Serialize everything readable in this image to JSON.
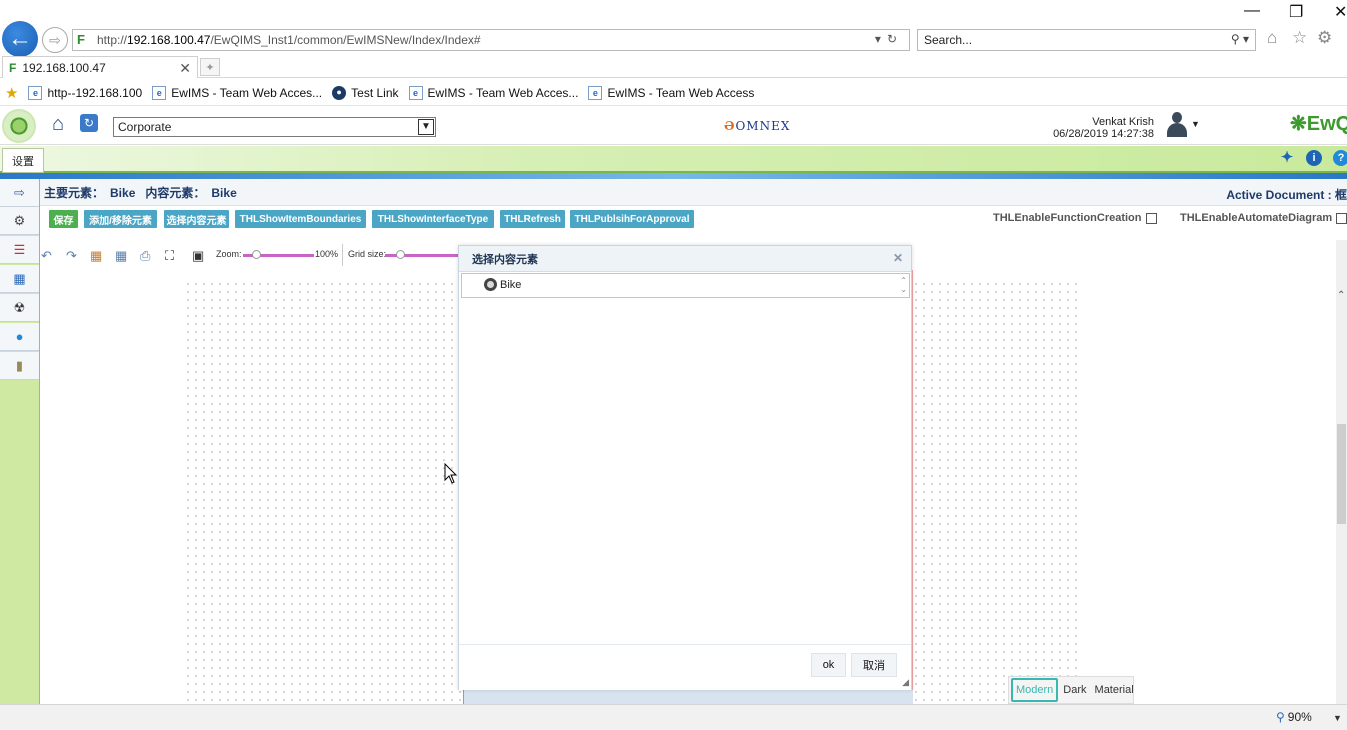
{
  "browser": {
    "url_prefix": "http://",
    "url_host": "192.168.100.47",
    "url_path": "/EwQIMS_Inst1/common/EwIMSNew/Index/Index#",
    "search_placeholder": "Search...",
    "tab_title": "192.168.100.47",
    "favorites": [
      {
        "label": "http--192.168.100",
        "icon": "ie-page-icon"
      },
      {
        "label": "EwIMS - Team Web Acces...",
        "icon": "ie-page-icon"
      },
      {
        "label": "Test Link",
        "icon": "testlink-icon"
      },
      {
        "label": "EwIMS - Team Web Acces...",
        "icon": "ie-page-icon"
      },
      {
        "label": "EwIMS - Team Web Access",
        "icon": "ie-page-icon"
      }
    ],
    "zoom": "90%"
  },
  "header": {
    "org_select": "Corporate",
    "center_logo": "OMNEX",
    "user_name": "Venkat Krish",
    "user_time": "06/28/2019 14:27:38",
    "brand": "EwQ"
  },
  "menu": {
    "tab_label": "设置"
  },
  "info": {
    "main_label": "主要元素：",
    "main_value": "Bike",
    "content_label": "内容元素：",
    "content_value": "Bike",
    "active_doc": "Active Document : 框"
  },
  "toolbar": {
    "buttons": [
      {
        "label": "保存",
        "color": "#4caf50"
      },
      {
        "label": "添加/移除元素",
        "color": "#4ba6c5"
      },
      {
        "label": "选择内容元素",
        "color": "#4ba6c5"
      },
      {
        "label": "THLShowItemBoundaries",
        "color": "#4ba6c5"
      },
      {
        "label": "THLShowInterfaceType",
        "color": "#4ba6c5"
      },
      {
        "label": "THLRefresh",
        "color": "#4ba6c5"
      },
      {
        "label": "THLPublsihForApproval",
        "color": "#4ba6c5"
      }
    ],
    "check_function": "THLEnableFunctionCreation",
    "check_automate": "THLEnableAutomateDiagram"
  },
  "diagram_tools": {
    "zoom_label": "Zoom:",
    "zoom_value": "100%",
    "grid_label": "Grid size:"
  },
  "dialog": {
    "title": "选择内容元素",
    "items": [
      "Bike"
    ],
    "ok_label": "ok",
    "cancel_label": "取消"
  },
  "themes": {
    "modern": "Modern",
    "dark": "Dark",
    "material": "Material",
    "selected": "Modern"
  }
}
